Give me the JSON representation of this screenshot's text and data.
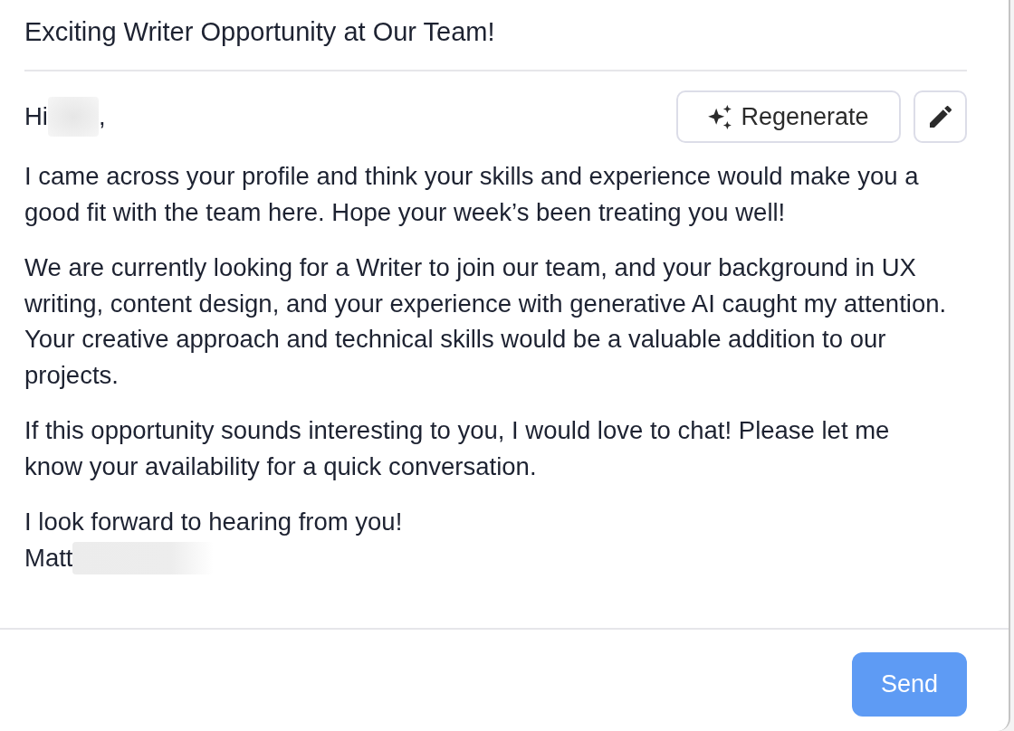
{
  "subject": "Exciting Writer Opportunity at Our Team!",
  "toolbar": {
    "regenerate_label": "Regenerate"
  },
  "message": {
    "greeting": {
      "text": "Hi",
      "redacted": true,
      "trailing": ","
    },
    "paragraphs": [
      "I came across your profile and think your skills and experience would make you a good fit with the team here. Hope your week’s been treating you well!",
      "We are currently looking for a Writer to join our team, and your background in UX writing, content design, and your experience with generative AI caught my attention. Your creative approach and technical skills would be a valuable addition to our projects.",
      "If this opportunity sounds interesting to you, I would love to chat! Please let me know your availability for a quick conversation."
    ],
    "closing": "I look forward to hearing from you!",
    "signature": {
      "text": "Matt",
      "redacted": true
    }
  },
  "send_button": "Send"
}
